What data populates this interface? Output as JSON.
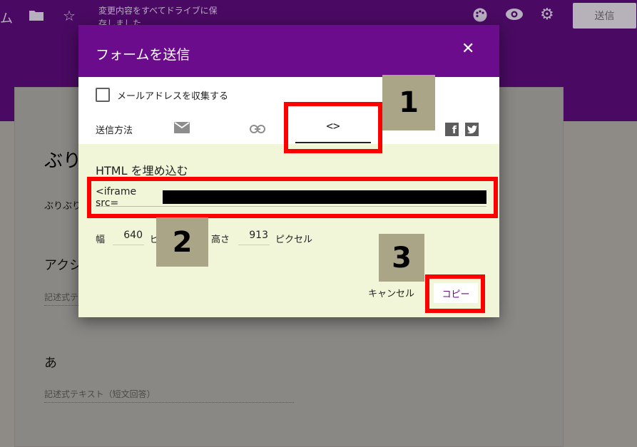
{
  "topbar": {
    "title_fragment": "ム",
    "save_status": "変更内容をすべてドライブに保存しました",
    "send_button": "送信",
    "icons": {
      "folder": "folder-icon",
      "star": "star-icon",
      "palette": "palette-icon",
      "preview": "eye-icon",
      "settings": "gear-icon"
    }
  },
  "form": {
    "title": "ぶり",
    "description": "ぶりぶり",
    "questions": [
      {
        "title": "アクシ",
        "placeholder": "記述式テ"
      },
      {
        "title": "あ",
        "placeholder": "記述式テキスト（短文回答）"
      }
    ]
  },
  "dialog": {
    "title": "フォームを送信",
    "collect_email_label": "メールアドレスを収集する",
    "collect_email_checked": false,
    "send_method_label": "送信方法",
    "methods": [
      {
        "id": "email",
        "icon": "mail-icon"
      },
      {
        "id": "link",
        "icon": "link-icon"
      },
      {
        "id": "embed",
        "icon": "code-icon",
        "glyph": "<>",
        "selected": true
      }
    ],
    "social": {
      "facebook": "f",
      "twitter": "t"
    },
    "embed": {
      "heading": "HTML を埋め込む",
      "code_prefix": "<iframe src="
    },
    "size": {
      "width_label": "幅",
      "width_value": "640",
      "width_unit": "ピ",
      "height_label": "高さ",
      "height_value": "913",
      "height_unit": "ピクセル"
    },
    "cancel_label": "キャンセル",
    "copy_label": "コピー"
  },
  "annotations": {
    "badge_1": "1",
    "badge_2": "2",
    "badge_3": "3",
    "highlight_color": "#ff0000",
    "badge_color": "#aaa587"
  }
}
